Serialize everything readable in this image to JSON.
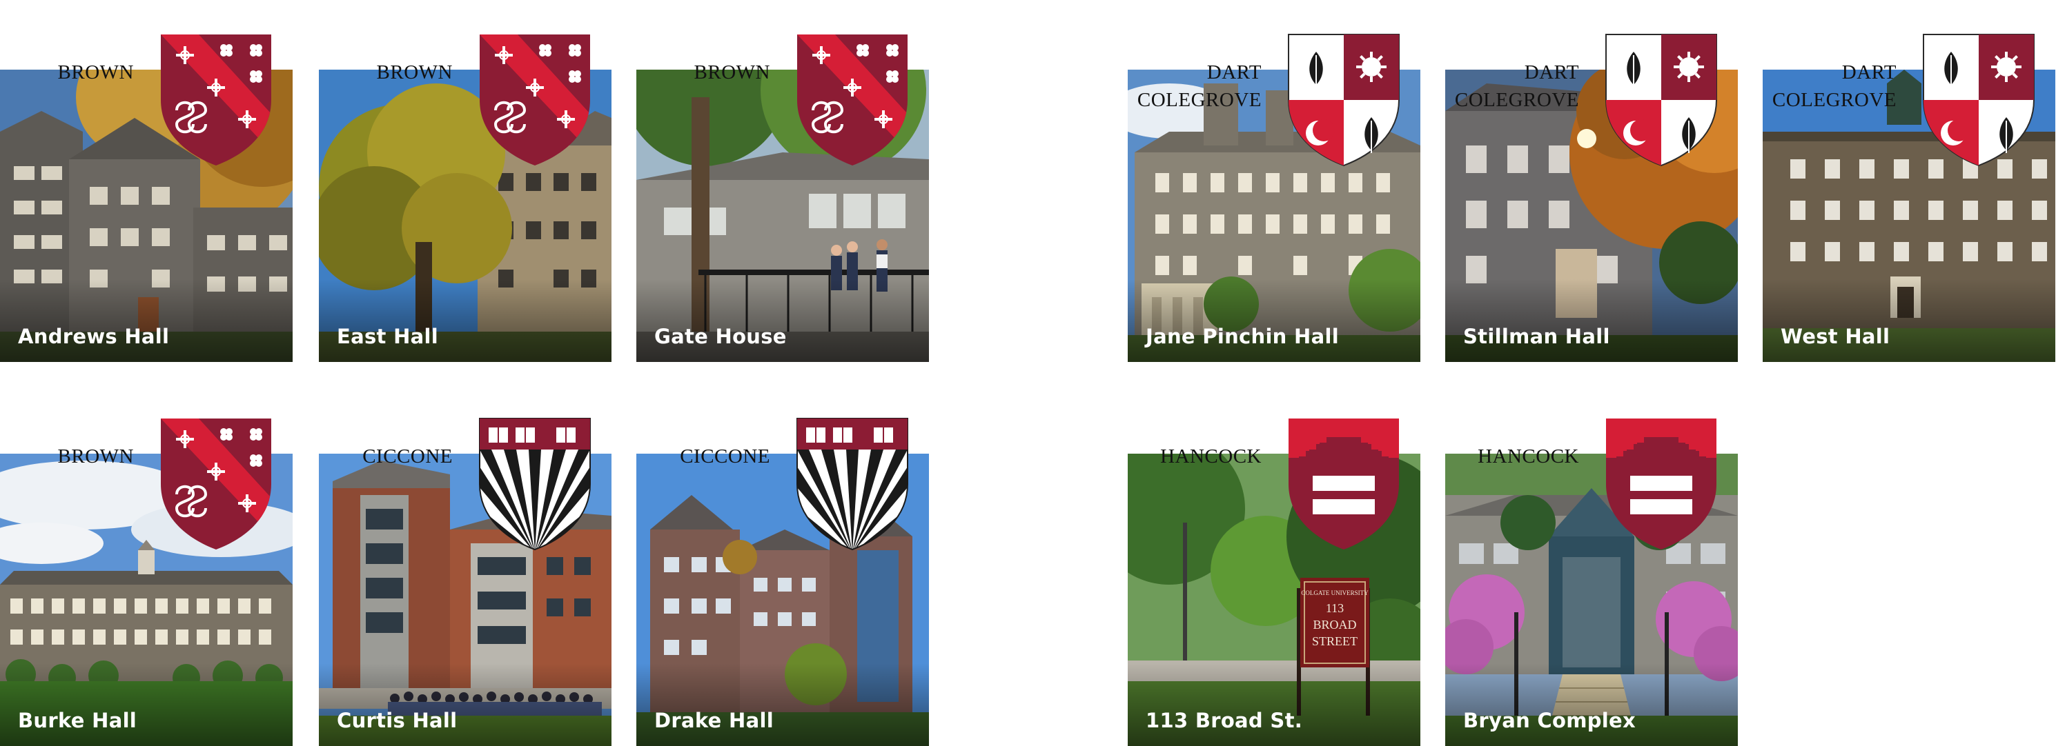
{
  "cards": [
    {
      "hall": "Andrews Hall",
      "college": [
        "BROWN"
      ],
      "crest": "brown",
      "photo": "stone-dorm-autumn"
    },
    {
      "hall": "East Hall",
      "college": [
        "BROWN"
      ],
      "crest": "brown",
      "photo": "tree-stone-dorm"
    },
    {
      "hall": "Gate House",
      "college": [
        "BROWN"
      ],
      "crest": "brown",
      "photo": "ramp-students"
    },
    {
      "hall": "Jane Pinchin Hall",
      "college": [
        "DART",
        "COLEGROVE"
      ],
      "crest": "colegrove",
      "photo": "stone-hall-blue-sky"
    },
    {
      "hall": "Stillman Hall",
      "college": [
        "DART",
        "COLEGROVE"
      ],
      "crest": "colegrove",
      "photo": "stone-hall-sun-autumn"
    },
    {
      "hall": "West Hall",
      "college": [
        "DART",
        "COLEGROVE"
      ],
      "crest": "colegrove",
      "photo": "stone-hall-cupola"
    },
    {
      "hall": "Burke Hall",
      "college": [
        "BROWN"
      ],
      "crest": "brown",
      "photo": "long-dorm-lawn"
    },
    {
      "hall": "Curtis Hall",
      "college": [
        "CICCONE"
      ],
      "crest": "ciccone",
      "photo": "brick-tower-crowd"
    },
    {
      "hall": "Drake Hall",
      "college": [
        "CICCONE"
      ],
      "crest": "ciccone",
      "photo": "brick-glass-dorm"
    },
    {
      "hall": "113 Broad St.",
      "college": [
        "HANCOCK"
      ],
      "crest": "hancock",
      "photo": "street-sign-trees"
    },
    {
      "hall": "Bryan Complex",
      "college": [
        "HANCOCK"
      ],
      "crest": "hancock",
      "photo": "complex-pink-trees"
    }
  ],
  "sign": [
    "COLGATE UNIVERSITY",
    "113",
    "BROAD",
    "STREET"
  ],
  "crest_icons": {
    "brown": "brown-college-crest-icon",
    "colegrove": "colegrove-college-crest-icon",
    "ciccone": "ciccone-college-crest-icon",
    "hancock": "hancock-college-crest-icon"
  },
  "colors": {
    "maroon": "#8c1c34",
    "red": "#d51e36",
    "white": "#ffffff",
    "black": "#1a1a1a"
  }
}
